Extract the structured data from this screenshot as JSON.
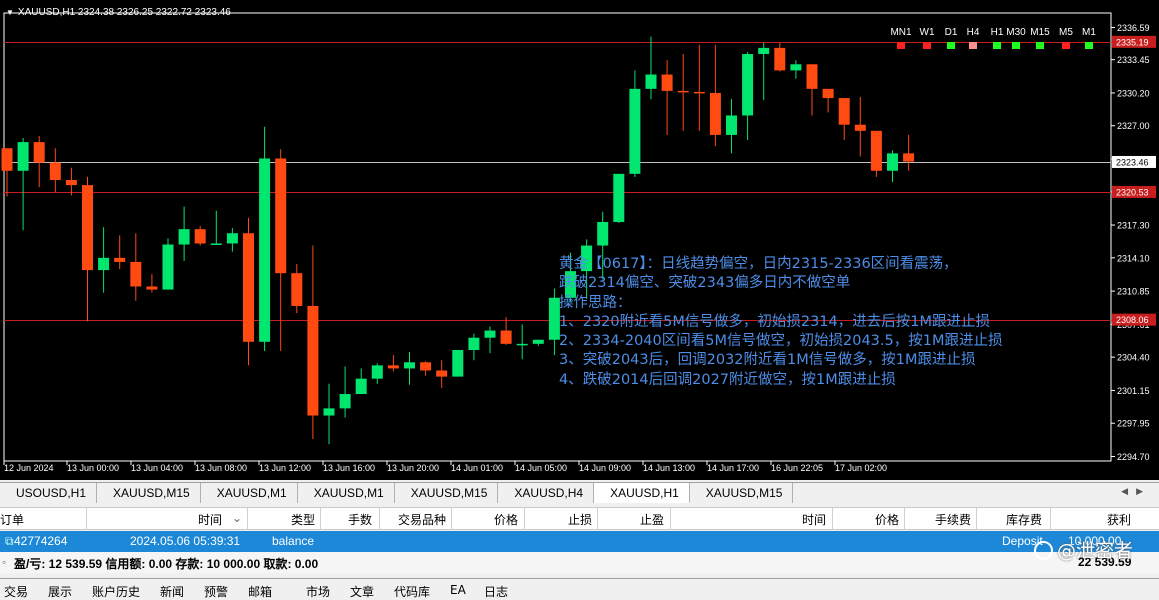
{
  "chart": {
    "symbol_info": "XAUUSD,H1  2324.38 2326.25 2322.72 2323.46",
    "colors": {
      "bull": "#00e66e",
      "bear": "#ff4a12",
      "hline": "#c81e1e",
      "current": "#c0c0c0",
      "axis": "#ffffff"
    },
    "price_axis": {
      "min": 2294.7,
      "max": 2337.0,
      "ticks": [
        "2336.59",
        "2333.45",
        "2330.20",
        "2327.00",
        "2323.76",
        "2320.53",
        "2317.30",
        "2314.10",
        "2310.85",
        "2307.61",
        "2304.40",
        "2301.15",
        "2297.95",
        "2294.70"
      ]
    },
    "hlines": [
      {
        "price": 2335.19,
        "label": "2335.19"
      },
      {
        "price": 2320.53,
        "label": "2320.53"
      },
      {
        "price": 2308.06,
        "label": "2308.06"
      }
    ],
    "current": {
      "price": 2323.46,
      "label": "2323.46"
    },
    "time_labels": [
      "12 Jun 2024",
      "13 Jun 00:00",
      "13 Jun 04:00",
      "13 Jun 08:00",
      "13 Jun 12:00",
      "13 Jun 16:00",
      "13 Jun 20:00",
      "14 Jun 01:00",
      "14 Jun 05:00",
      "14 Jun 09:00",
      "14 Jun 13:00",
      "14 Jun 17:00",
      "16 Jun 22:05",
      "17 Jun 02:00"
    ],
    "candles": [
      [
        2324.8,
        2324.8,
        2320.1,
        2322.6
      ],
      [
        2322.6,
        2325.8,
        2316.8,
        2325.4
      ],
      [
        2325.4,
        2326.0,
        2321.0,
        2323.4
      ],
      [
        2323.4,
        2324.8,
        2320.5,
        2321.7
      ],
      [
        2321.7,
        2322.9,
        2320.2,
        2321.2
      ],
      [
        2321.2,
        2322.0,
        2307.9,
        2312.9
      ],
      [
        2312.9,
        2317.1,
        2310.7,
        2314.1
      ],
      [
        2314.1,
        2316.3,
        2313.0,
        2313.7
      ],
      [
        2313.7,
        2316.5,
        2309.9,
        2311.3
      ],
      [
        2311.3,
        2312.5,
        2310.7,
        2311.0
      ],
      [
        2311.0,
        2316.0,
        2311.0,
        2315.4
      ],
      [
        2315.4,
        2319.1,
        2313.8,
        2316.9
      ],
      [
        2316.9,
        2317.2,
        2315.3,
        2315.5
      ],
      [
        2315.5,
        2318.7,
        2315.4,
        2315.5
      ],
      [
        2315.5,
        2317.0,
        2314.7,
        2316.5
      ],
      [
        2316.5,
        2318.0,
        2303.6,
        2305.9
      ],
      [
        2305.9,
        2326.9,
        2305.0,
        2323.8
      ],
      [
        2323.8,
        2324.7,
        2305.0,
        2312.6
      ],
      [
        2312.6,
        2313.5,
        2308.7,
        2309.4
      ],
      [
        2309.4,
        2315.3,
        2296.4,
        2298.7
      ],
      [
        2298.7,
        2301.8,
        2295.9,
        2299.4
      ],
      [
        2299.4,
        2303.5,
        2298.5,
        2300.8
      ],
      [
        2300.8,
        2303.3,
        2300.8,
        2302.3
      ],
      [
        2302.3,
        2303.8,
        2301.8,
        2303.6
      ],
      [
        2303.6,
        2304.6,
        2303.0,
        2303.3
      ],
      [
        2303.3,
        2304.9,
        2301.7,
        2303.9
      ],
      [
        2303.9,
        2304.0,
        2302.6,
        2303.1
      ],
      [
        2303.1,
        2304.1,
        2301.4,
        2302.5
      ],
      [
        2302.5,
        2305.1,
        2302.5,
        2305.1
      ],
      [
        2305.1,
        2306.7,
        2304.1,
        2306.3
      ],
      [
        2306.3,
        2307.4,
        2304.8,
        2307.0
      ],
      [
        2307.0,
        2308.3,
        2305.6,
        2305.7
      ],
      [
        2305.7,
        2307.6,
        2304.2,
        2305.7
      ],
      [
        2305.7,
        2306.0,
        2305.5,
        2306.1
      ],
      [
        2306.1,
        2311.1,
        2304.6,
        2310.2
      ],
      [
        2310.2,
        2314.6,
        2309.8,
        2312.8
      ],
      [
        2312.8,
        2315.9,
        2310.1,
        2315.3
      ],
      [
        2315.3,
        2318.6,
        2312.0,
        2317.6
      ],
      [
        2317.6,
        2322.3,
        2317.5,
        2322.3
      ],
      [
        2322.3,
        2332.4,
        2322.0,
        2330.6
      ],
      [
        2330.6,
        2335.7,
        2329.6,
        2332.0
      ],
      [
        2332.0,
        2333.4,
        2326.1,
        2330.4
      ],
      [
        2330.4,
        2334.0,
        2326.5,
        2330.3
      ],
      [
        2330.3,
        2334.9,
        2326.5,
        2330.2
      ],
      [
        2330.2,
        2334.9,
        2325.0,
        2326.1
      ],
      [
        2326.1,
        2329.6,
        2324.3,
        2328.0
      ],
      [
        2328.0,
        2334.2,
        2325.6,
        2334.0
      ],
      [
        2334.0,
        2335.1,
        2329.5,
        2334.6
      ],
      [
        2334.6,
        2335.1,
        2332.3,
        2332.4
      ],
      [
        2332.4,
        2333.4,
        2331.6,
        2333.0
      ],
      [
        2333.0,
        2331.2,
        2328.0,
        2330.6
      ],
      [
        2330.6,
        2330.3,
        2328.3,
        2329.7
      ],
      [
        2329.7,
        2328.4,
        2325.6,
        2327.1
      ],
      [
        2327.1,
        2329.8,
        2324.0,
        2326.5
      ],
      [
        2326.5,
        2326.0,
        2322.0,
        2322.6
      ],
      [
        2322.6,
        2324.6,
        2321.5,
        2324.3
      ],
      [
        2324.3,
        2326.1,
        2322.6,
        2323.5
      ]
    ]
  },
  "timeframes": [
    {
      "label": "MN1",
      "color": "#ff2020"
    },
    {
      "label": "W1",
      "color": "#ff2020"
    },
    {
      "label": "D1",
      "color": "#20ff20"
    },
    {
      "label": "H4",
      "color": "#ff9090"
    },
    {
      "label": "H1",
      "color": "#20ff20"
    },
    {
      "label": "M30",
      "color": "#20ff20"
    },
    {
      "label": "M15",
      "color": "#20ff20"
    },
    {
      "label": "M5",
      "color": "#ff2020"
    },
    {
      "label": "M1",
      "color": "#20ff20"
    }
  ],
  "annotation": {
    "lines": [
      "黄金【0617】：日线趋势偏空，日内2315-2336区间看震荡，",
      "跌破2314偏空、突破2343偏多日内不做空单",
      "操作思路：",
      "1、2320附近看5M信号做多，初始损2314，进去后按1M跟进止损",
      "2、2334-2040区间看5M信号做空，初始损2043.5，按1M跟进止损",
      "3、突破2043后，回调2032附近看1M信号做多，按1M跟进止损",
      "4、跌破2014后回调2027附近做空，按1M跟进止损"
    ]
  },
  "chart_tabs": [
    "USOUSD,H1",
    "XAUUSD,M15",
    "XAUUSD,M1",
    "XAUUSD,M1",
    "XAUUSD,M15",
    "XAUUSD,H4",
    "XAUUSD,H1",
    "XAUUSD,M15"
  ],
  "active_tab": 6,
  "table": {
    "headers": [
      "订单",
      "时间",
      "类型",
      "手数",
      "交易品种",
      "价格",
      "止损",
      "止盈",
      "时间",
      "价格",
      "手续费",
      "库存费",
      "获利"
    ],
    "sort_indicator": "⌄",
    "row": {
      "order": "42774264",
      "time": "2024.05.06 05:39:31",
      "type": "balance",
      "comment": "Deposit",
      "profit": "10 000.00"
    },
    "summary": "盈/亏: 12 539.59  信用额: 0.00  存款: 10 000.00  取款: 0.00",
    "summary_total": "22 539.59"
  },
  "bottom_tabs": [
    "交易",
    "展示",
    "账户历史",
    "新闻",
    "预警",
    "邮箱",
    "市场",
    "文章",
    "代码库",
    "EA",
    "日志"
  ],
  "watermark": "@泄密者"
}
